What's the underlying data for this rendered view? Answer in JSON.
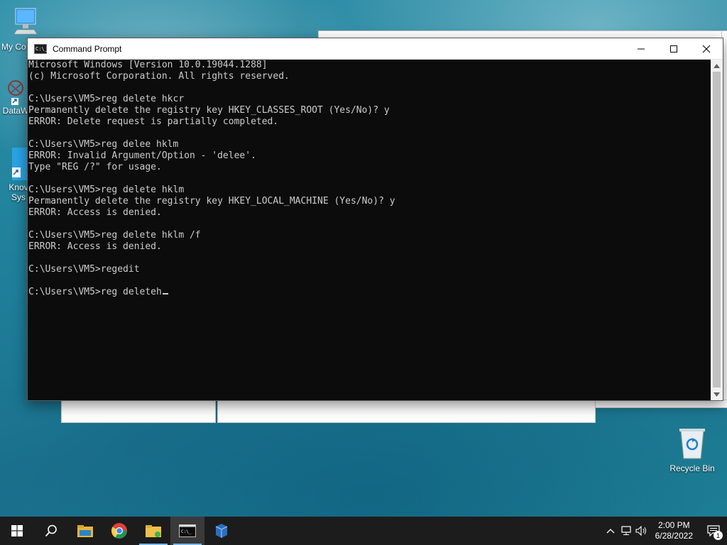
{
  "desktop": {
    "icons": [
      {
        "label": "My Co",
        "name": "my-computer-icon"
      },
      {
        "label": "DataW",
        "name": "dataw-shortcut-icon"
      },
      {
        "label": "Knov",
        "label2": "Sys",
        "name": "knowledge-system-shortcut-icon"
      },
      {
        "label": "Recycle Bin",
        "name": "recycle-bin-icon"
      }
    ]
  },
  "window": {
    "title": "Command Prompt",
    "console_lines": [
      "Microsoft Windows [Version 10.0.19044.1288]",
      "(c) Microsoft Corporation. All rights reserved.",
      "",
      "C:\\Users\\VM5>reg delete hkcr",
      "Permanently delete the registry key HKEY_CLASSES_ROOT (Yes/No)? y",
      "ERROR: Delete request is partially completed.",
      "",
      "C:\\Users\\VM5>reg delee hklm",
      "ERROR: Invalid Argument/Option - 'delee'.",
      "Type \"REG /?\" for usage.",
      "",
      "C:\\Users\\VM5>reg delete hklm",
      "Permanently delete the registry key HKEY_LOCAL_MACHINE (Yes/No)? y",
      "ERROR: Access is denied.",
      "",
      "C:\\Users\\VM5>reg delete hklm /f",
      "ERROR: Access is denied.",
      "",
      "C:\\Users\\VM5>regedit",
      ""
    ],
    "current_input": "C:\\Users\\VM5>reg deleteh"
  },
  "taskbar": {
    "items": [
      "start-icon",
      "search-icon",
      "file-explorer-icon",
      "chrome-icon",
      "folder-icon",
      "command-prompt-icon",
      "app-icon"
    ],
    "clock_time": "2:00 PM",
    "clock_date": "6/28/2022",
    "notification_count": "1"
  },
  "colors": {
    "console_bg": "#0c0c0c",
    "console_text": "#cccccc",
    "taskbar": "#1c1c1c"
  }
}
